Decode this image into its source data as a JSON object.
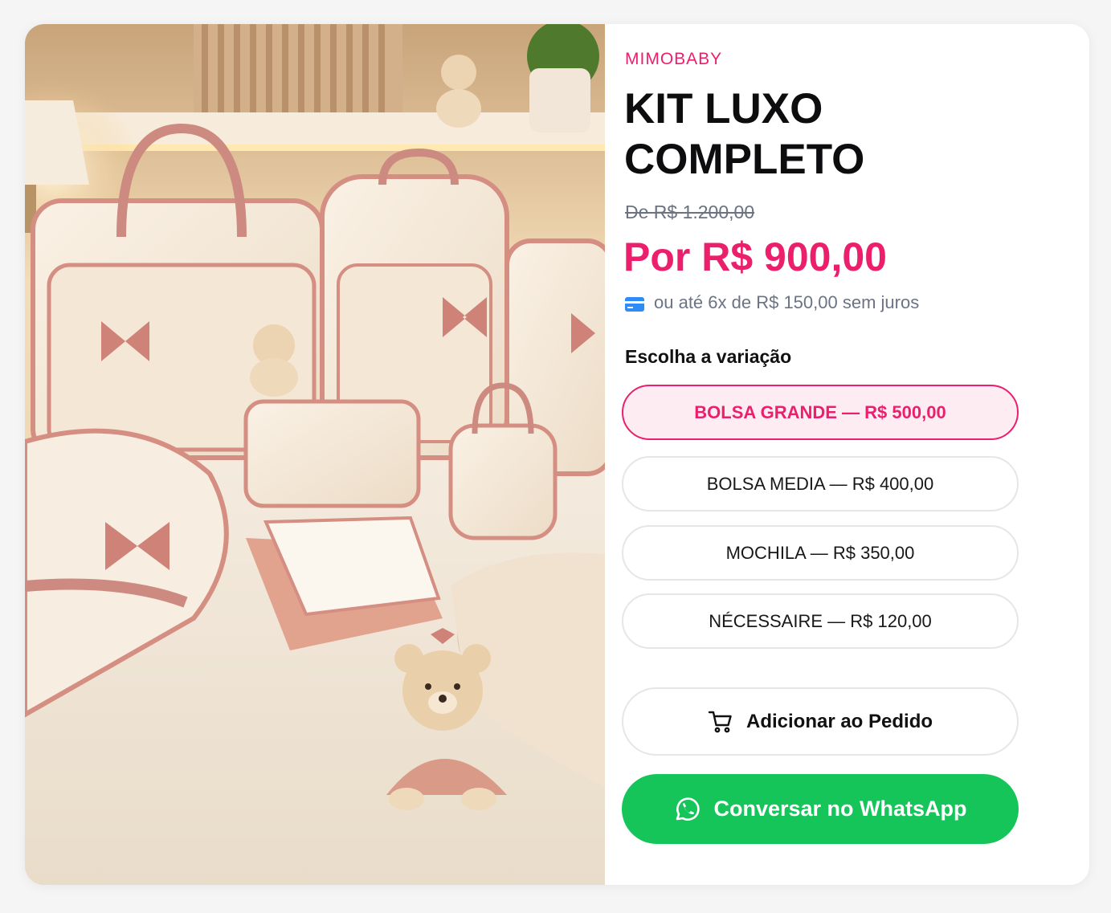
{
  "product": {
    "brand": "MIMOBABY",
    "title": "KIT LUXO COMPLETO",
    "old_price": "De R$ 1.200,00",
    "price": "Por R$ 900,00",
    "installments": "ou até 6x de R$ 150,00 sem juros",
    "image_description_icon": "product-photo"
  },
  "variations": {
    "label": "Escolha a variação",
    "options": [
      {
        "label": "BOLSA GRANDE — R$ 500,00",
        "selected": true
      },
      {
        "label": "BOLSA MEDIA — R$ 400,00",
        "selected": false
      },
      {
        "label": "MOCHILA — R$ 350,00",
        "selected": false
      },
      {
        "label": "NÉCESSAIRE — R$ 120,00",
        "selected": false
      }
    ]
  },
  "actions": {
    "add_label": "Adicionar ao Pedido",
    "add_icon": "cart-icon",
    "whatsapp_label": "Conversar no WhatsApp",
    "whatsapp_icon": "whatsapp-icon"
  },
  "colors": {
    "accent": "#ec1f6d",
    "whatsapp": "#16c55a",
    "text": "#111114",
    "muted": "#6b7384"
  }
}
